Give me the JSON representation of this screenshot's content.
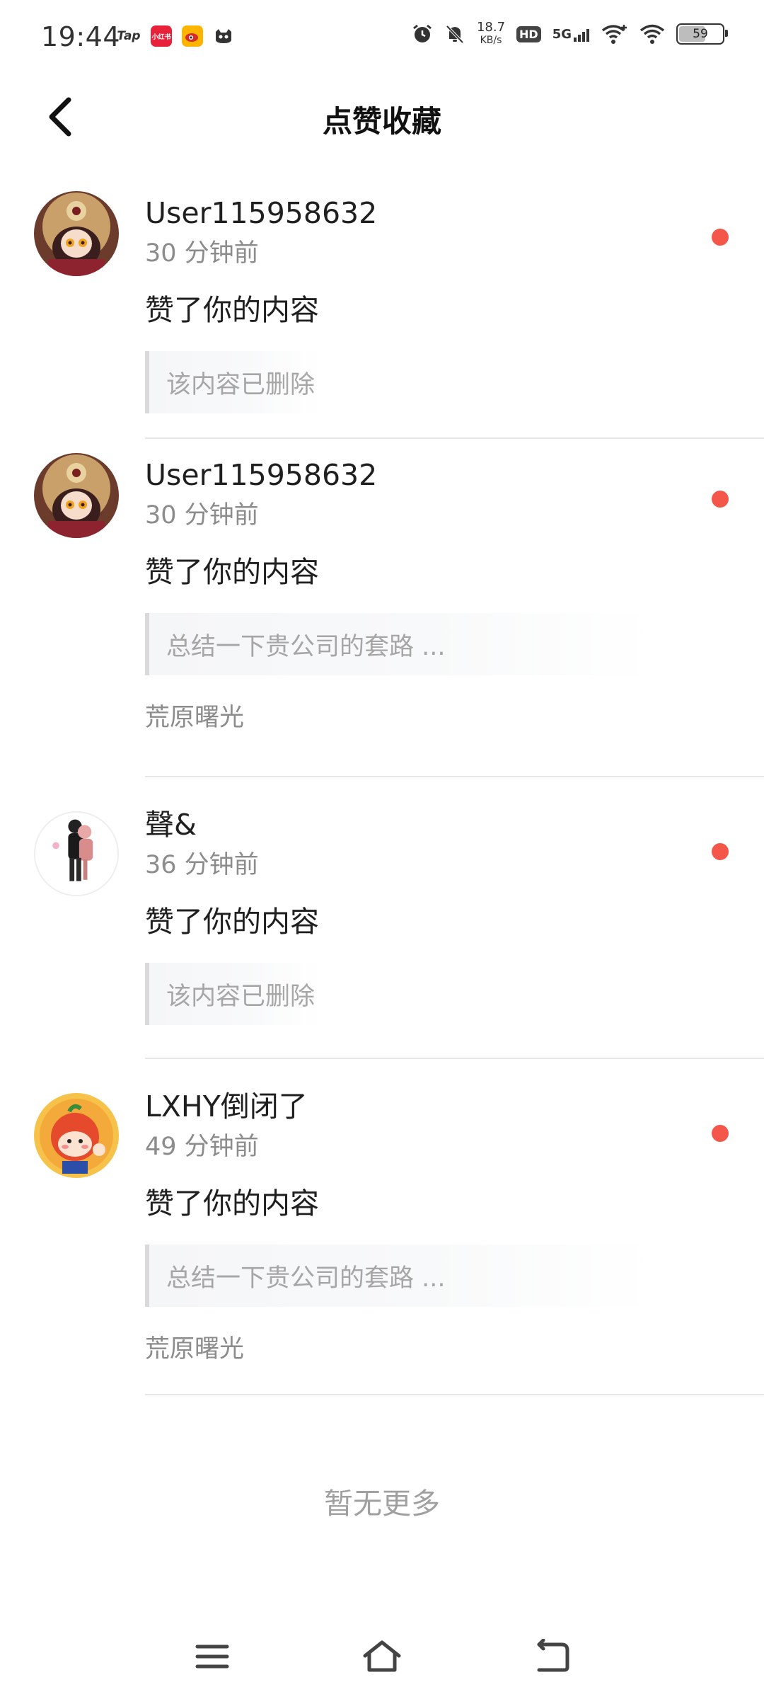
{
  "status_bar": {
    "time": "19:44",
    "apps": [
      "Tap",
      "小红书",
      "微博",
      "猫"
    ],
    "net_speed_value": "18.7",
    "net_speed_unit": "KB/s",
    "hd": "HD",
    "network": "5G",
    "battery": "59"
  },
  "header": {
    "title": "点赞收藏"
  },
  "notifications": [
    {
      "username": "User115958632",
      "time": "30 分钟前",
      "action": "赞了你的内容",
      "quote": "该内容已删除",
      "source": ""
    },
    {
      "username": "User115958632",
      "time": "30 分钟前",
      "action": "赞了你的内容",
      "quote": "总结一下贵公司的套路 ...",
      "source": "荒原曙光"
    },
    {
      "username": "聲&",
      "time": "36 分钟前",
      "action": "赞了你的内容",
      "quote": "该内容已删除",
      "source": ""
    },
    {
      "username": "LXHY倒闭了",
      "time": "49 分钟前",
      "action": "赞了你的内容",
      "quote": "总结一下贵公司的套路 ...",
      "source": "荒原曙光"
    }
  ],
  "footer": {
    "no_more": "暂无更多"
  },
  "colors": {
    "accent_dot": "#f5564a",
    "text_primary": "#1f1f1f",
    "text_secondary": "#8c8c8c"
  },
  "icons": {
    "back": "chevron-left-icon",
    "menu": "menu-icon",
    "home": "home-icon",
    "return": "return-icon"
  }
}
